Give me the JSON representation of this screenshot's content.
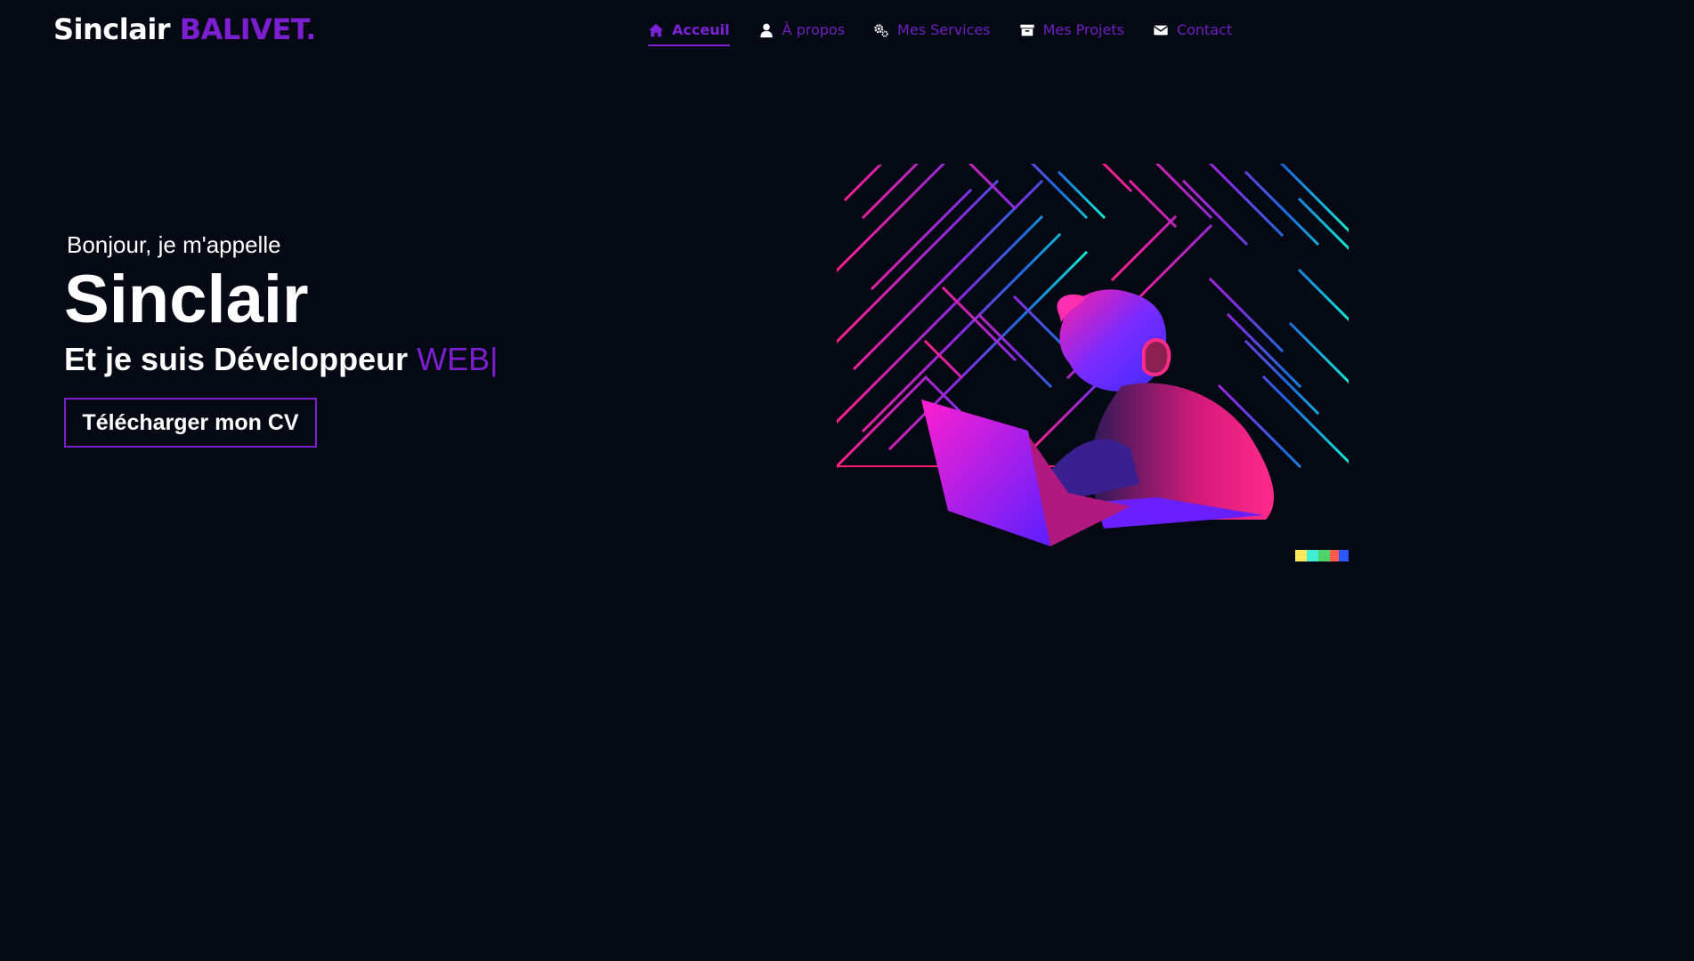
{
  "brand": {
    "first": "Sinclair",
    "last": "BALIVET."
  },
  "nav": {
    "items": [
      {
        "label": "Acceuil",
        "icon": "home-icon",
        "active": true
      },
      {
        "label": "À propos",
        "icon": "user-icon"
      },
      {
        "label": "Mes Services",
        "icon": "gears-icon"
      },
      {
        "label": "Mes Projets",
        "icon": "archive-icon"
      },
      {
        "label": "Contact",
        "icon": "envelope-icon"
      }
    ]
  },
  "hero": {
    "greeting": "Bonjour, je m'appelle",
    "name": "Sinclair",
    "role_prefix": "Et je suis Développeur",
    "role_highlight": "WEB|",
    "cv_button": "Télécharger mon CV"
  },
  "colors": {
    "background": "#050914",
    "accent": "#7c1fd0",
    "text": "#ffffff"
  }
}
